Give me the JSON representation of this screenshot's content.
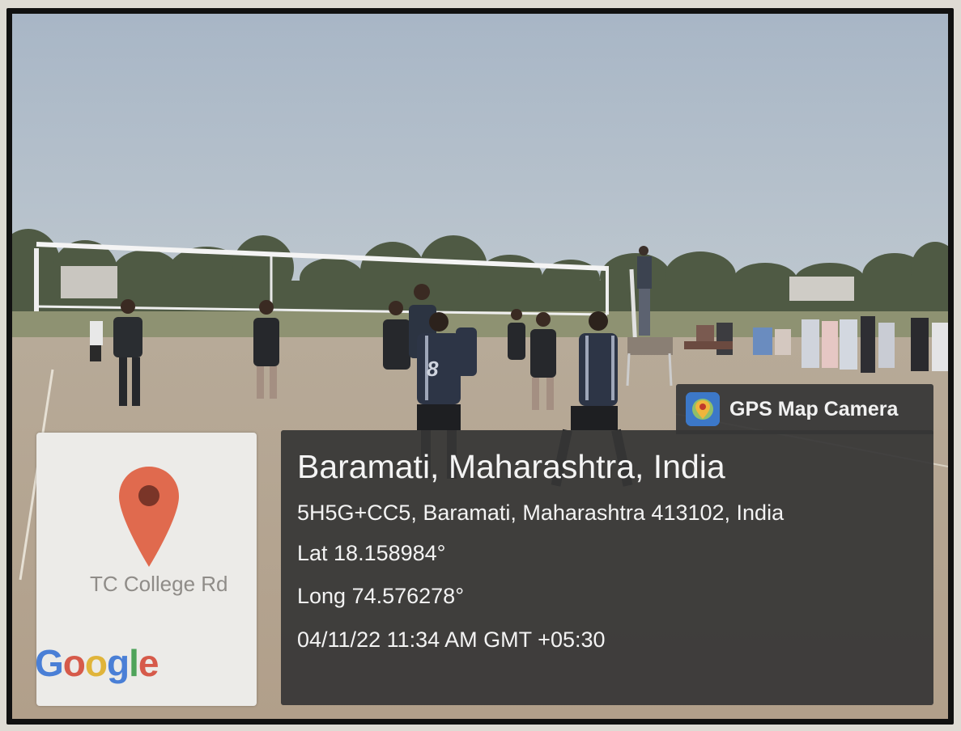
{
  "overlay": {
    "app_name": "GPS Map Camera",
    "place": "Baramati, Maharashtra, India",
    "address": "5H5G+CC5, Baramati, Maharashtra 413102, India",
    "latitude": "Lat 18.158984°",
    "longitude": "Long 74.576278°",
    "timestamp": "04/11/22 11:34 AM GMT +05:30"
  },
  "map": {
    "road_label": "TC College Rd",
    "logo": {
      "g1": "G",
      "o1": "o",
      "o2": "o",
      "g2": "g",
      "l": "l",
      "e": "e"
    }
  },
  "jerseys": {
    "front_player": "8"
  },
  "colors": {
    "sky": "#a9b8c9",
    "ground": "#b9a995",
    "panel": "#363636",
    "pin": "#e06a4e",
    "app_icon": "#3c78c8"
  },
  "icons": {
    "location_pin": "map-pin-icon",
    "app": "gps-map-camera-app-icon"
  }
}
